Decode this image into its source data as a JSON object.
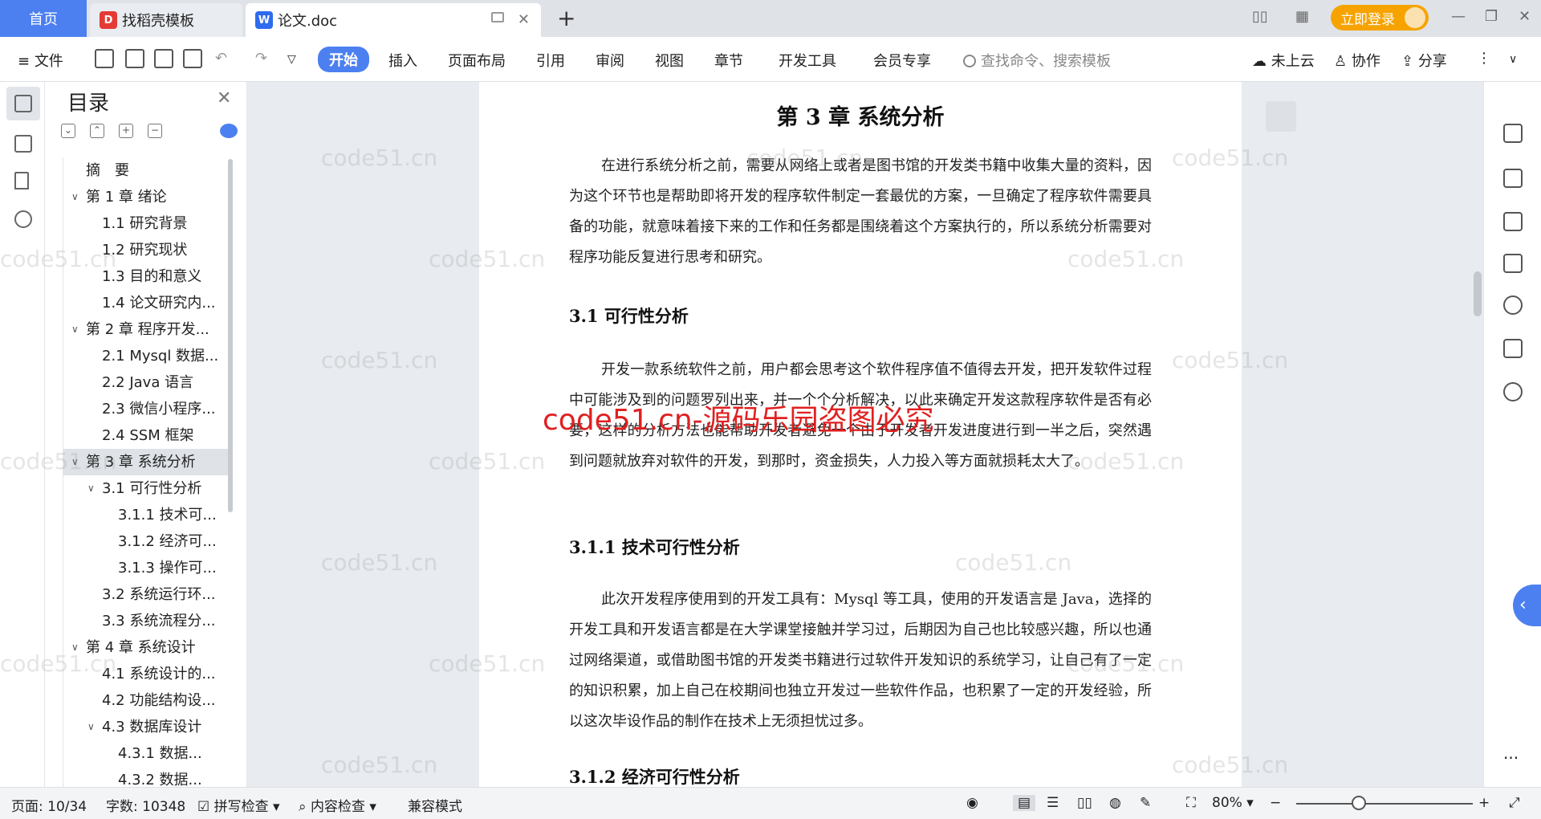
{
  "titlebar": {
    "home_tab": "首页",
    "tab1_label": "找稻壳模板",
    "tab2_label": "论文.doc",
    "login_label": "立即登录"
  },
  "menu": {
    "file": "文件",
    "items": [
      "开始",
      "插入",
      "页面布局",
      "引用",
      "审阅",
      "视图",
      "章节",
      "开发工具",
      "会员专享"
    ],
    "search_placeholder": "查找命令、搜索模板",
    "cloud": "未上云",
    "collab": "协作",
    "share": "分享"
  },
  "toc": {
    "title": "目录",
    "items": [
      {
        "label": "摘　要",
        "level": 0
      },
      {
        "label": "第 1 章 绪论",
        "level": 0,
        "expanded": true
      },
      {
        "label": "1.1 研究背景",
        "level": 1
      },
      {
        "label": "1.2 研究现状",
        "level": 1
      },
      {
        "label": "1.3 目的和意义",
        "level": 1
      },
      {
        "label": "1.4 论文研究内...",
        "level": 1
      },
      {
        "label": "第 2 章 程序开发...",
        "level": 0,
        "expanded": true
      },
      {
        "label": "2.1 Mysql 数据...",
        "level": 1
      },
      {
        "label": "2.2 Java 语言",
        "level": 1
      },
      {
        "label": "2.3 微信小程序...",
        "level": 1
      },
      {
        "label": "2.4 SSM 框架",
        "level": 1
      },
      {
        "label": "第 3 章 系统分析",
        "level": 0,
        "expanded": true,
        "selected": true
      },
      {
        "label": "3.1 可行性分析",
        "level": 1,
        "expanded": true
      },
      {
        "label": "3.1.1 技术可...",
        "level": 2
      },
      {
        "label": "3.1.2 经济可...",
        "level": 2
      },
      {
        "label": "3.1.3 操作可...",
        "level": 2
      },
      {
        "label": "3.2 系统运行环...",
        "level": 1
      },
      {
        "label": "3.3 系统流程分...",
        "level": 1
      },
      {
        "label": "第 4 章 系统设计",
        "level": 0,
        "expanded": true
      },
      {
        "label": "4.1 系统设计的...",
        "level": 1
      },
      {
        "label": "4.2 功能结构设...",
        "level": 1
      },
      {
        "label": "4.3 数据库设计",
        "level": 1,
        "expanded": true
      },
      {
        "label": "4.3.1 数据...",
        "level": 2
      },
      {
        "label": "4.3.2 数据...",
        "level": 2
      }
    ]
  },
  "document": {
    "chapter_title": "第 3 章  系统分析",
    "intro": "在进行系统分析之前，需要从网络上或者是图书馆的开发类书籍中收集大量的资料，因为这个环节也是帮助即将开发的程序软件制定一套最优的方案，一旦确定了程序软件需要具备的功能，就意味着接下来的工作和任务都是围绕着这个方案执行的，所以系统分析需要对程序功能反复进行思考和研究。",
    "h_31": "3.1 可行性分析",
    "p_31": "开发一款系统软件之前，用户都会思考这个软件程序值不值得去开发，把开发软件过程中可能涉及到的问题罗列出来，并一个个分析解决，以此来确定开发这款程序软件是否有必要，这样的分析方法也能帮助开发者避免一个由于开发者开发进度进行到一半之后，突然遇到问题就放弃对软件的开发，到那时，资金损失，人力投入等方面就损耗太大了。",
    "h_311": "3.1.1 技术可行性分析",
    "p_311": "此次开发程序使用到的开发工具有：Mysql 等工具，使用的开发语言是 Java，选择的开发工具和开发语言都是在大学课堂接触并学习过，后期因为自己也比较感兴趣，所以也通过网络渠道，或借助图书馆的开发类书籍进行过软件开发知识的系统学习，让自己有了一定的知识积累，加上自己在校期间也独立开发过一些软件作品，也积累了一定的开发经验，所以这次毕设作品的制作在技术上无须担忧过多。",
    "h_312": "3.1.2 经济可行性分析"
  },
  "watermark": {
    "text": "code51.cn",
    "red_text": "code51.cn-源码乐园盗图必究"
  },
  "statusbar": {
    "page": "页面: 10/34",
    "words": "字数: 10348",
    "spell": "拼写检查",
    "content_check": "内容检查",
    "compat": "兼容模式",
    "zoom": "80%"
  },
  "colors": {
    "accent": "#4c80f1",
    "login": "#f6a300",
    "red_watermark": "#e02020"
  }
}
